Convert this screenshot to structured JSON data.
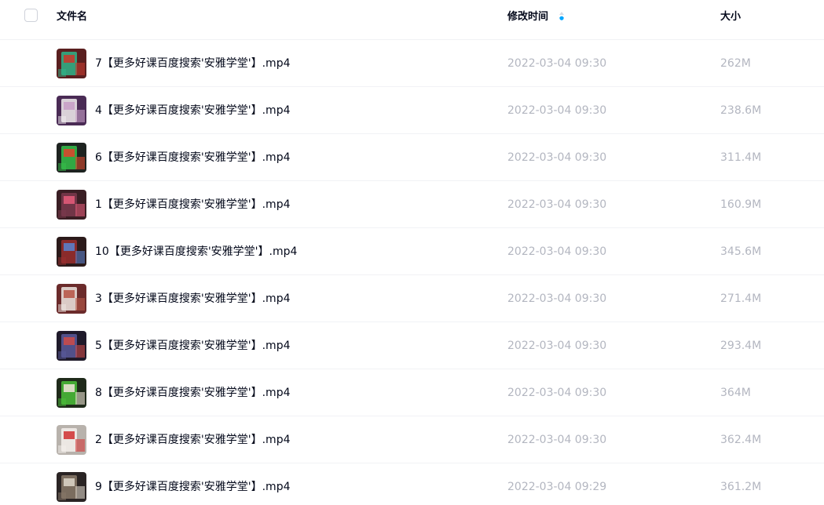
{
  "header": {
    "name_label": "文件名",
    "time_label": "修改时间",
    "size_label": "大小"
  },
  "accent_color": "#06a7ff",
  "files": [
    {
      "name": "7【更多好课百度搜索'安雅学堂'】.mp4",
      "time": "2022-03-04 09:30",
      "size": "262M",
      "thumb": [
        "#5a1f1f",
        "#2fb58a",
        "#c43b2e"
      ]
    },
    {
      "name": "4【更多好课百度搜索'安雅学堂'】.mp4",
      "time": "2022-03-04 09:30",
      "size": "238.6M",
      "thumb": [
        "#4a2b55",
        "#f2eef0",
        "#c8a0c8"
      ]
    },
    {
      "name": "6【更多好课百度搜索'安雅学堂'】.mp4",
      "time": "2022-03-04 09:30",
      "size": "311.4M",
      "thumb": [
        "#1e2320",
        "#35c04a",
        "#d8472e"
      ]
    },
    {
      "name": "1【更多好课百度搜索'安雅学堂'】.mp4",
      "time": "2022-03-04 09:30",
      "size": "160.9M",
      "thumb": [
        "#3a1e24",
        "#7b3a4e",
        "#e05a78"
      ]
    },
    {
      "name": "10【更多好课百度搜索'安雅学堂'】.mp4",
      "time": "2022-03-04 09:30",
      "size": "345.6M",
      "thumb": [
        "#2b1a1a",
        "#9b2f2f",
        "#5a7ec8"
      ]
    },
    {
      "name": "3【更多好课百度搜索'安雅学堂'】.mp4",
      "time": "2022-03-04 09:30",
      "size": "271.4M",
      "thumb": [
        "#6b2b2b",
        "#efe7e2",
        "#b85a4a"
      ]
    },
    {
      "name": "5【更多好课百度搜索'安雅学堂'】.mp4",
      "time": "2022-03-04 09:30",
      "size": "293.4M",
      "thumb": [
        "#1f1a2a",
        "#5a5a9b",
        "#c84a4a"
      ]
    },
    {
      "name": "8【更多好课百度搜索'安雅学堂'】.mp4",
      "time": "2022-03-04 09:30",
      "size": "364M",
      "thumb": [
        "#1f2a1a",
        "#4bbf3a",
        "#e8e0d0"
      ]
    },
    {
      "name": "2【更多好课百度搜索'安雅学堂'】.mp4",
      "time": "2022-03-04 09:30",
      "size": "362.4M",
      "thumb": [
        "#b8b2ac",
        "#f4f0ec",
        "#d23a3a"
      ]
    },
    {
      "name": "9【更多好课百度搜索'安雅学堂'】.mp4",
      "time": "2022-03-04 09:29",
      "size": "361.2M",
      "thumb": [
        "#2a2424",
        "#8a7a6a",
        "#d8d0c4"
      ]
    }
  ]
}
